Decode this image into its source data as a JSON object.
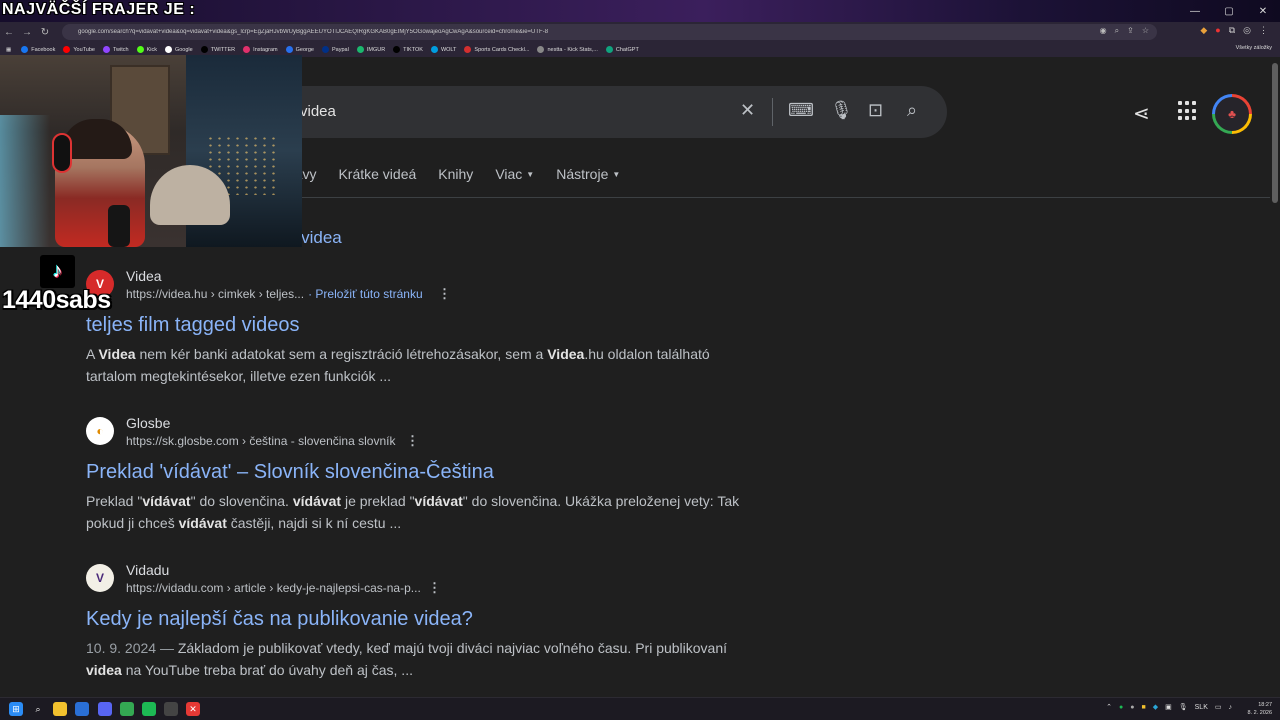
{
  "overlay": {
    "title": "NAJVÄČŠÍ FRAJER JE :",
    "channel_name": "1440sabs"
  },
  "browser": {
    "url": "google.com/search?q=vidavat+videa&oq=vidavat+videa&gs_lcrp=EgZjaHJvbWUyBggAEEUYOTIJCAEQIRgKGKAB0gEIMjY5OGowajeoAgCwAgA&sourceid=chrome&ie=UTF-8",
    "bookmarks": [
      {
        "label": "Facebook",
        "color": "#1877f2"
      },
      {
        "label": "YouTube",
        "color": "#ff0000"
      },
      {
        "label": "Twitch",
        "color": "#9146ff"
      },
      {
        "label": "Kick",
        "color": "#53fc18"
      },
      {
        "label": "Google",
        "color": "#ffffff"
      },
      {
        "label": "TWITTER",
        "color": "#000000"
      },
      {
        "label": "Instagram",
        "color": "#e1306c"
      },
      {
        "label": "George",
        "color": "#2870ed"
      },
      {
        "label": "Paypal",
        "color": "#003087"
      },
      {
        "label": "IMGUR",
        "color": "#1bb76e"
      },
      {
        "label": "TIKTOK",
        "color": "#010101"
      },
      {
        "label": "WOLT",
        "color": "#009de0"
      },
      {
        "label": "Sports Cards Checkl...",
        "color": "#d32f2f"
      },
      {
        "label": "nestta - Kick Stats,...",
        "color": "#888888"
      },
      {
        "label": "ChatGPT",
        "color": "#10a37f"
      }
    ],
    "all_bookmarks": "Všetky záložky"
  },
  "search": {
    "query": "videa"
  },
  "tabs": [
    {
      "label": "rávy",
      "has_caret": false
    },
    {
      "label": "Krátke videá",
      "has_caret": false
    },
    {
      "label": "Knihy",
      "has_caret": false
    },
    {
      "label": "Viac",
      "has_caret": true
    },
    {
      "label": "Nástroje",
      "has_caret": true
    }
  ],
  "did_you_mean": "ť videa",
  "results": [
    {
      "site_name": "Videa",
      "url": "https://videa.hu › cimkek › teljes...",
      "translate": "· Preložiť túto stránku",
      "title": "teljes film tagged videos",
      "date": "",
      "snippet": [
        {
          "t": "A ",
          "b": false
        },
        {
          "t": "Videa",
          "b": true
        },
        {
          "t": " nem kér banki adatokat sem a regisztráció létrehozásakor, sem a ",
          "b": false
        },
        {
          "t": "Videa",
          "b": true
        },
        {
          "t": ".hu oldalon található tartalom megtekintésekor, illetve ezen funkciók ...",
          "b": false
        }
      ],
      "fav_bg": "#d62a2a",
      "fav_fg": "#ffffff",
      "fav_glyph": "V"
    },
    {
      "site_name": "Glosbe",
      "url": "https://sk.glosbe.com › čeština - slovenčina slovník",
      "translate": "",
      "title": "Preklad 'vídávat' – Slovník slovenčina-Čeština",
      "date": "",
      "snippet": [
        {
          "t": "Preklad \"",
          "b": false
        },
        {
          "t": "vídávat",
          "b": true
        },
        {
          "t": "\" do slovenčina. ",
          "b": false
        },
        {
          "t": "vídávat",
          "b": true
        },
        {
          "t": " je preklad \"",
          "b": false
        },
        {
          "t": "vídávat",
          "b": true
        },
        {
          "t": "\" do slovenčina. Ukážka preloženej vety: Tak pokud ji chceš ",
          "b": false
        },
        {
          "t": "vídávat",
          "b": true
        },
        {
          "t": " častěji, najdi si k ní cestu ...",
          "b": false
        }
      ],
      "fav_bg": "#ffffff",
      "fav_fg": "#e08a00",
      "fav_glyph": "◐"
    },
    {
      "site_name": "Vidadu",
      "url": "https://vidadu.com › article › kedy-je-najlepsi-cas-na-p...",
      "translate": "",
      "title": "Kedy je najlepší čas na publikovanie videa?",
      "date": "10. 9. 2024 — ",
      "snippet": [
        {
          "t": "Základom je publikovať vtedy, keď majú tvoji diváci najviac voľného času. Pri publikovaní ",
          "b": false
        },
        {
          "t": "videa",
          "b": true
        },
        {
          "t": " na YouTube treba brať do úvahy deň aj čas, ...",
          "b": false
        }
      ],
      "fav_bg": "#f2efe6",
      "fav_fg": "#4b2a7a",
      "fav_glyph": "V"
    }
  ],
  "taskbar": {
    "apps": [
      {
        "name": "start",
        "color": "#2b8cf5",
        "glyph": "⊞"
      },
      {
        "name": "search",
        "color": "transparent",
        "glyph": "⌕"
      },
      {
        "name": "files",
        "color": "#f2c12e",
        "glyph": ""
      },
      {
        "name": "store",
        "color": "#2a6fd6",
        "glyph": ""
      },
      {
        "name": "discord",
        "color": "#5865f2",
        "glyph": ""
      },
      {
        "name": "chrome",
        "color": "#34a853",
        "glyph": ""
      },
      {
        "name": "spotify",
        "color": "#1db954",
        "glyph": ""
      },
      {
        "name": "app",
        "color": "#444444",
        "glyph": ""
      },
      {
        "name": "app2",
        "color": "#e53935",
        "glyph": "✕"
      }
    ],
    "lang": "SLK",
    "time": "18:27",
    "date": "8. 2. 2026"
  }
}
